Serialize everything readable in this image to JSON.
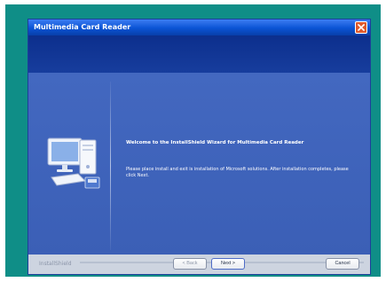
{
  "window": {
    "title": "Multimedia Card Reader"
  },
  "content": {
    "heading": "Welcome to the InstallShield Wizard for Multimedia Card Reader",
    "body": "Please place install and exit is installation of Microsoft solutions. After installation completes, please click Next."
  },
  "footer": {
    "brand": "InstallShield",
    "back_label": "< Back",
    "next_label": "Next >",
    "cancel_label": "Cancel"
  },
  "icons": {
    "close": "close-icon",
    "computer": "computer-icon"
  },
  "colors": {
    "frame": "#0f8e87",
    "titlebar": "#0a53d4",
    "header": "#0c2f8d",
    "panel": "#4368c0",
    "footer": "#cdd4e0",
    "close": "#df5a2c"
  }
}
